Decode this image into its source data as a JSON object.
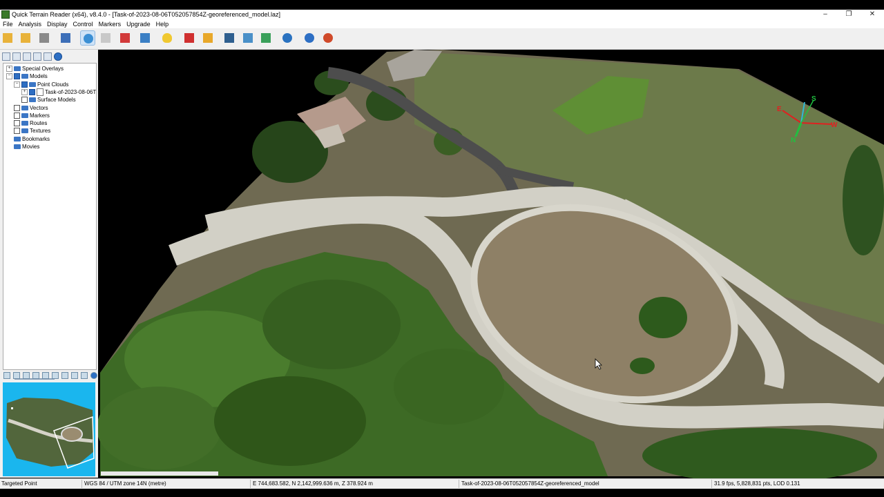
{
  "window": {
    "title": "Quick Terrain Reader (x64), v8.4.0 - [Task-of-2023-08-06T052057854Z-georeferenced_model.laz]",
    "minimize": "–",
    "maximize": "❐",
    "close": "✕"
  },
  "menu": [
    "File",
    "Analysis",
    "Display",
    "Control",
    "Markers",
    "Upgrade",
    "Help"
  ],
  "toolbar": {
    "tools": [
      {
        "name": "open-folder-icon",
        "color": "#e8b23a"
      },
      {
        "name": "add-folder-icon",
        "color": "#e8b23a"
      },
      {
        "name": "trash-icon",
        "color": "#8a8a8a"
      },
      {
        "name": "layout-icon",
        "color": "#3d6fb8"
      },
      {
        "name": "globe-navigate-icon",
        "color": "#3b8fd4"
      },
      {
        "name": "blank-document-icon",
        "color": "#c8c8c8"
      },
      {
        "name": "color-palette-icon",
        "color": "#d23a3a"
      },
      {
        "name": "zoom-extents-icon",
        "color": "#3b7fc4"
      },
      {
        "name": "lightbulb-icon",
        "color": "#f0c830"
      },
      {
        "name": "marker-pin-icon",
        "color": "#d03030"
      },
      {
        "name": "triangle-ruler-icon",
        "color": "#e8a82a"
      },
      {
        "name": "profile-chart-icon",
        "color": "#2f5f8f"
      },
      {
        "name": "grid-settings-icon",
        "color": "#4a90c8"
      },
      {
        "name": "elevation-arrows-icon",
        "color": "#3aa05a"
      },
      {
        "name": "movie-camera-icon",
        "color": "#2a72c0"
      },
      {
        "name": "help-icon",
        "color": "#2d6fc4"
      },
      {
        "name": "exit-icon",
        "color": "#d04a2a"
      }
    ]
  },
  "tree": {
    "items": [
      {
        "label": "Special Overlays",
        "level": 0,
        "expand": "+",
        "checkbox": false,
        "checked": false
      },
      {
        "label": "Models",
        "level": 0,
        "expand": "−",
        "checkbox": true,
        "checked": true
      },
      {
        "label": "Point Clouds",
        "level": 1,
        "expand": "−",
        "checkbox": true,
        "checked": true
      },
      {
        "label": "Task-of-2023-08-06T",
        "level": 2,
        "expand": "+",
        "checkbox": true,
        "checked": true,
        "file": true
      },
      {
        "label": "Surface Models",
        "level": 1,
        "expand": "",
        "checkbox": true,
        "checked": false
      },
      {
        "label": "Vectors",
        "level": 0,
        "expand": "",
        "checkbox": true,
        "checked": false
      },
      {
        "label": "Markers",
        "level": 0,
        "expand": "",
        "checkbox": true,
        "checked": false
      },
      {
        "label": "Routes",
        "level": 0,
        "expand": "",
        "checkbox": true,
        "checked": false
      },
      {
        "label": "Textures",
        "level": 0,
        "expand": "",
        "checkbox": true,
        "checked": false
      },
      {
        "label": "Bookmarks",
        "level": 0,
        "expand": "",
        "checkbox": false,
        "checked": false
      },
      {
        "label": "Movies",
        "level": 0,
        "expand": "",
        "checkbox": false,
        "checked": false
      }
    ]
  },
  "compass": {
    "n": "N",
    "s": "S",
    "e": "E",
    "w": "W"
  },
  "status": {
    "mode": "Targeted Point",
    "crs": "WGS 84 / UTM zone 14N (metre)",
    "coords": "E 744,683.582, N 2,142,999.636 m, Z 378.924 m",
    "model": "Task-of-2023-08-06T052057854Z-georeferenced_model",
    "perf": "31.9 fps, 5,828,831 pts, LOD 0.131"
  },
  "colors": {
    "minimap_bg": "#1ab6ee",
    "compass_red": "#e02020",
    "compass_green": "#20c040",
    "compass_cyan": "#30b8d8"
  }
}
